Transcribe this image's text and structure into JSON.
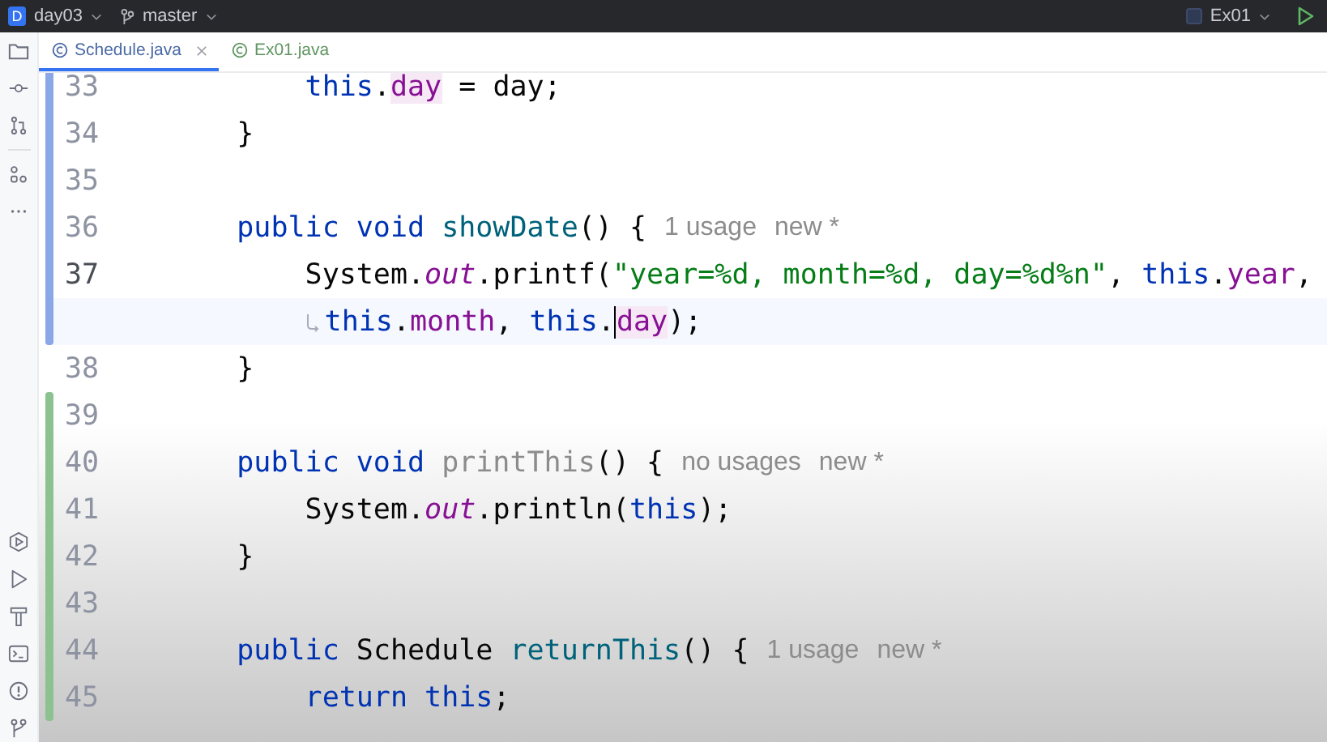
{
  "title_bar": {
    "project_badge": "D",
    "project": "day03",
    "branch": "master",
    "run_config": "Ex01"
  },
  "tabs": [
    {
      "label": "Schedule.java",
      "selected": true,
      "color": "#4a6aa5",
      "closable": true
    },
    {
      "label": "Ex01.java",
      "selected": false,
      "color": "#5f9560",
      "closable": false
    }
  ],
  "lines": [
    {
      "number": "33",
      "kind": "modified",
      "current": false,
      "wrap": false,
      "tokens": [
        {
          "kind": "kw",
          "text": "        this"
        },
        {
          "kind": "plain",
          "text": "."
        },
        {
          "kind": "field",
          "text": "day",
          "highlighted": true,
          "caret": false
        },
        {
          "kind": "plain",
          "text": " = day;"
        }
      ]
    },
    {
      "number": "34",
      "kind": "modified",
      "current": false,
      "wrap": false,
      "tokens": [
        {
          "kind": "plain",
          "text": "    }"
        }
      ]
    },
    {
      "number": "35",
      "kind": "modified",
      "current": false,
      "wrap": false
    },
    {
      "number": "36",
      "kind": "modified",
      "current": false,
      "wrap": false,
      "tokens": [
        {
          "kind": "kw",
          "text": "    public void "
        },
        {
          "kind": "method",
          "text": "showDate"
        },
        {
          "kind": "plain",
          "text": "() {"
        }
      ],
      "hints": [
        "1 usage",
        "new *"
      ]
    },
    {
      "number": "37",
      "kind": "modified",
      "current": true,
      "wrap": false,
      "tokens": [
        {
          "kind": "plain",
          "text": "        System."
        },
        {
          "kind": "static",
          "text": "out"
        },
        {
          "kind": "plain",
          "text": ".printf("
        },
        {
          "kind": "string",
          "text": "\"year=%d, month=%d, day=%d%n\""
        },
        {
          "kind": "plain",
          "text": ", "
        },
        {
          "kind": "kw",
          "text": "this"
        },
        {
          "kind": "plain",
          "text": "."
        },
        {
          "kind": "field",
          "text": "year"
        },
        {
          "kind": "plain",
          "text": ","
        }
      ]
    },
    {
      "kind": "modified",
      "current": true,
      "wrap": true,
      "tokens": [
        {
          "kind": "kw",
          "text": "this"
        },
        {
          "kind": "plain",
          "text": "."
        },
        {
          "kind": "field",
          "text": "month"
        },
        {
          "kind": "plain",
          "text": ", "
        },
        {
          "kind": "kw",
          "text": "this"
        },
        {
          "kind": "plain",
          "text": "."
        },
        {
          "kind": "field",
          "text": "day",
          "highlighted": true,
          "caret": true
        },
        {
          "kind": "plain",
          "text": ");"
        }
      ]
    },
    {
      "number": "38",
      "kind": "unchanged",
      "current": false,
      "wrap": false,
      "tokens": [
        {
          "kind": "plain",
          "text": "    }"
        }
      ]
    },
    {
      "number": "39",
      "kind": "added",
      "current": false,
      "wrap": false
    },
    {
      "number": "40",
      "kind": "added",
      "current": false,
      "wrap": false,
      "tokens": [
        {
          "kind": "kw",
          "text": "    public void "
        },
        {
          "kind": "unused",
          "text": "printThis"
        },
        {
          "kind": "plain",
          "text": "() {"
        }
      ],
      "hints": [
        "no usages",
        "new *"
      ]
    },
    {
      "number": "41",
      "kind": "added",
      "current": false,
      "wrap": false,
      "tokens": [
        {
          "kind": "plain",
          "text": "        System."
        },
        {
          "kind": "static",
          "text": "out"
        },
        {
          "kind": "plain",
          "text": ".println("
        },
        {
          "kind": "kw",
          "text": "this"
        },
        {
          "kind": "plain",
          "text": ");"
        }
      ]
    },
    {
      "number": "42",
      "kind": "added",
      "current": false,
      "wrap": false,
      "tokens": [
        {
          "kind": "plain",
          "text": "    }"
        }
      ]
    },
    {
      "number": "43",
      "kind": "added",
      "current": false,
      "wrap": false
    },
    {
      "number": "44",
      "kind": "added",
      "current": false,
      "wrap": false,
      "tokens": [
        {
          "kind": "kw",
          "text": "    public "
        },
        {
          "kind": "plain",
          "text": "Schedule "
        },
        {
          "kind": "method",
          "text": "returnThis"
        },
        {
          "kind": "plain",
          "text": "() {"
        }
      ],
      "hints": [
        "1 usage",
        "new *"
      ]
    },
    {
      "number": "45",
      "kind": "added",
      "current": false,
      "wrap": false,
      "tokens": [
        {
          "kind": "kw",
          "text": "        return this"
        },
        {
          "kind": "plain",
          "text": ";"
        }
      ]
    }
  ]
}
